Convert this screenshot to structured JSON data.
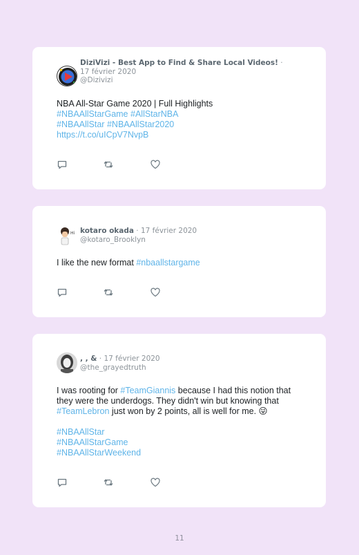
{
  "tweets": [
    {
      "name": "DiziVizi - Best App to Find & Share Local Videos!",
      "date": " · 17 février 2020",
      "handle": "@Dizivizi",
      "line1": "NBA All-Star Game 2020 | Full Highlights",
      "tag1": "#NBAAllStarGame",
      "tag2": "#AllStarNBA",
      "tag3": "#NBAAllStar",
      "tag4": "#NBAAllStar2020",
      "link": "https://t.co/uICpV7NvpB"
    },
    {
      "name": "kotaro okada",
      "date": " · 17 février 2020",
      "handle": "@kotaro_Brooklyn",
      "text": "I like the new format ",
      "tag1": "#nbaallstargame"
    },
    {
      "name": ", , &",
      "date": " · 17 février 2020",
      "handle": "@the_grayedtruth",
      "t1": "I was rooting for ",
      "tag1": "#TeamGiannis",
      "t2": " because I had this notion that they were the underdogs. They didn't win but knowing that ",
      "tag2": "#TeamLebron",
      "t3": " just won by 2 points, all is well for me. ",
      "emoji": "😜",
      "tag3": "#NBAAllStar",
      "tag4": "#NBAAllStarGame",
      "tag5": "#NBAAllStarWeekend"
    }
  ],
  "page_number": "11",
  "colors": {
    "background": "#f1e3f8",
    "card": "#ffffff",
    "hashtag": "#5fb4e8",
    "name": "#5b6770",
    "meta": "#8c9399"
  },
  "icons": [
    "reply-icon",
    "retweet-icon",
    "like-icon"
  ]
}
